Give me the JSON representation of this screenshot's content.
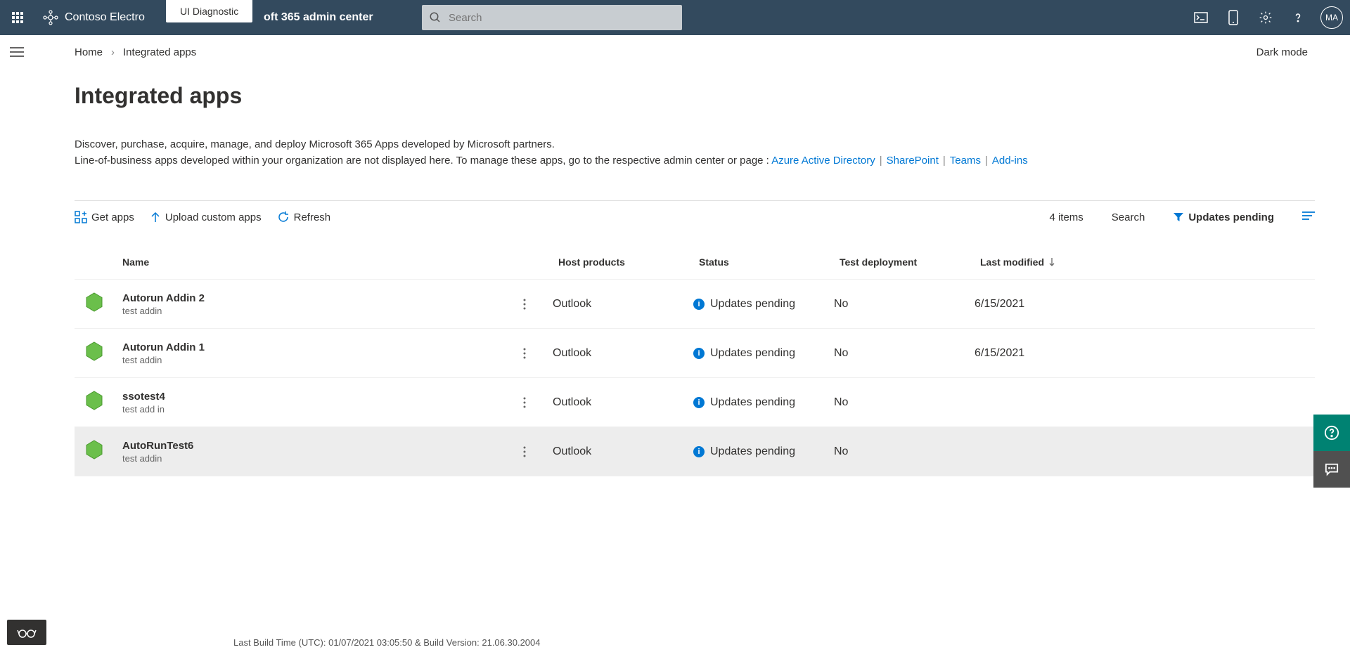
{
  "header": {
    "org_name": "Contoso Electro",
    "ui_diagnostic": "UI Diagnostic",
    "product_suffix": "oft 365 admin center",
    "search_placeholder": "Search",
    "avatar": "MA"
  },
  "breadcrumb": {
    "home": "Home",
    "current": "Integrated apps"
  },
  "dark_mode": "Dark mode",
  "page_title": "Integrated apps",
  "description": {
    "line1": "Discover, purchase, acquire, manage, and deploy Microsoft 365 Apps developed by Microsoft partners.",
    "line2_prefix": "Line-of-business apps developed within your organization are not displayed here. To manage these apps, go to the respective admin center or page : ",
    "links": {
      "aad": "Azure Active Directory",
      "sharepoint": "SharePoint",
      "teams": "Teams",
      "addins": "Add-ins"
    }
  },
  "toolbar": {
    "get_apps": "Get apps",
    "upload": "Upload custom apps",
    "refresh": "Refresh",
    "count": "4 items",
    "search": "Search",
    "filter": "Updates pending"
  },
  "columns": {
    "name": "Name",
    "host": "Host products",
    "status": "Status",
    "test": "Test deployment",
    "modified": "Last modified"
  },
  "rows": [
    {
      "name": "Autorun Addin 2",
      "sub": "test addin",
      "host": "Outlook",
      "status": "Updates pending",
      "test": "No",
      "modified": "6/15/2021"
    },
    {
      "name": "Autorun Addin 1",
      "sub": "test addin",
      "host": "Outlook",
      "status": "Updates pending",
      "test": "No",
      "modified": "6/15/2021"
    },
    {
      "name": "ssotest4",
      "sub": "test add in",
      "host": "Outlook",
      "status": "Updates pending",
      "test": "No",
      "modified": ""
    },
    {
      "name": "AutoRunTest6",
      "sub": "test addin",
      "host": "Outlook",
      "status": "Updates pending",
      "test": "No",
      "modified": ""
    }
  ],
  "footer": "Last Build Time (UTC): 01/07/2021 03:05:50 & Build Version: 21.06.30.2004"
}
